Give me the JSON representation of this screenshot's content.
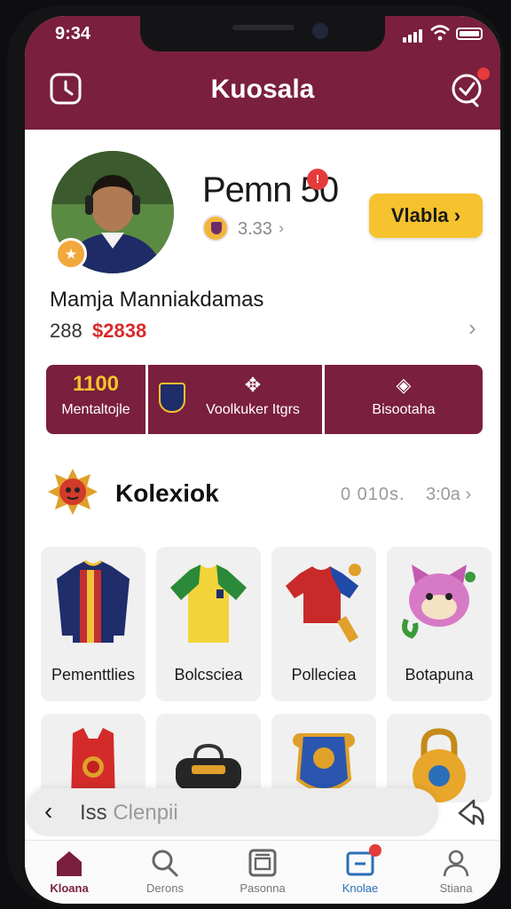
{
  "status_bar": {
    "time": "9:34"
  },
  "header": {
    "title": "Kuosala"
  },
  "profile": {
    "player_name": "Pemn 50",
    "club_value": "3.33",
    "view_button": "Vlabla",
    "full_name": "Mamja Manniakdamas",
    "stat_number": "288",
    "stat_money": "$2838"
  },
  "stats": [
    {
      "value": "1100",
      "label": "Mentaltojle"
    },
    {
      "label": "Voolkuker Itgrs"
    },
    {
      "label": "Bisootaha"
    }
  ],
  "collection": {
    "title": "Kolexiok",
    "count": "0 010s.",
    "more": "3:0a"
  },
  "cards": [
    {
      "label": "Pementtlies"
    },
    {
      "label": "Bolcsciea"
    },
    {
      "label": "Polleciea"
    },
    {
      "label": "Botapuna"
    }
  ],
  "search": {
    "prefix": "Iss",
    "placeholder": "Clenpii"
  },
  "tabs": [
    {
      "label": "Kloana"
    },
    {
      "label": "Derons"
    },
    {
      "label": "Pasonna"
    },
    {
      "label": "Knolae"
    },
    {
      "label": "Stiana"
    }
  ],
  "colors": {
    "brand": "#7a1f3d",
    "accent_yellow": "#f6c22d",
    "badge_red": "#e53b3b",
    "active_tab": "#2a6fb8"
  }
}
